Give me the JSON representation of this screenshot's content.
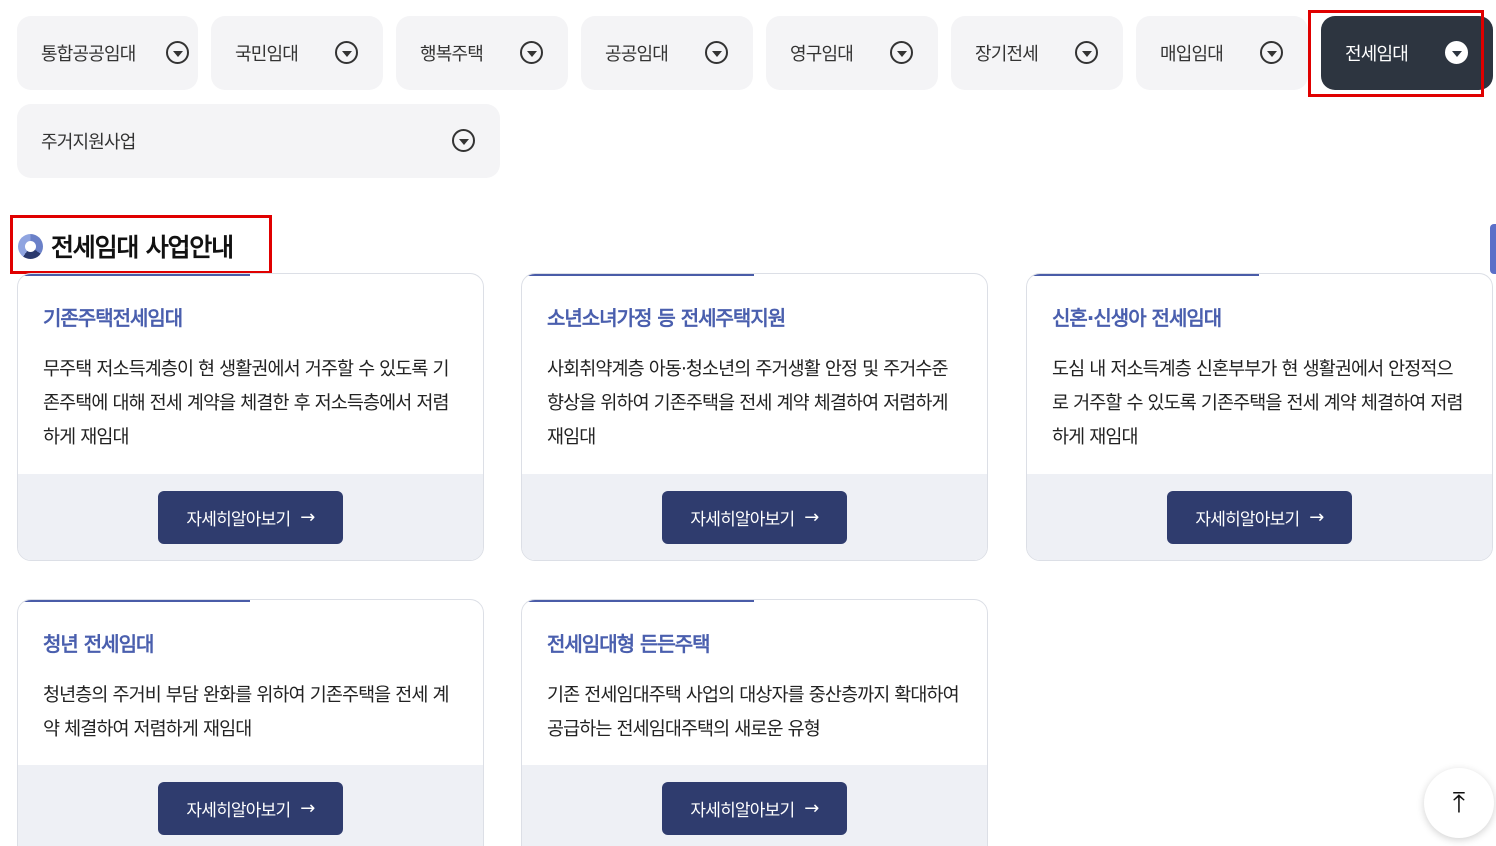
{
  "tabs": [
    {
      "label": "통합공공임대",
      "active": false
    },
    {
      "label": "국민임대",
      "active": false
    },
    {
      "label": "행복주택",
      "active": false
    },
    {
      "label": "공공임대",
      "active": false
    },
    {
      "label": "영구임대",
      "active": false
    },
    {
      "label": "장기전세",
      "active": false
    },
    {
      "label": "매입임대",
      "active": false
    },
    {
      "label": "전세임대",
      "active": true
    },
    {
      "label": "주거지원사업",
      "active": false
    }
  ],
  "section": {
    "title": "전세임대 사업안내"
  },
  "cards": [
    {
      "title": "기존주택전세임대",
      "description": "무주택 저소득계층이 현 생활권에서 거주할 수 있도록 기존주택에 대해 전세 계약을 체결한 후 저소득층에서 저렴하게 재임대",
      "button": "자세히알아보기"
    },
    {
      "title": "소년소녀가정 등 전세주택지원",
      "description": "사회취약계층 아동·청소년의 주거생활 안정 및 주거수준 향상을 위하여 기존주택을 전세 계약 체결하여 저렴하게 재임대",
      "button": "자세히알아보기"
    },
    {
      "title": "신혼·신생아 전세임대",
      "description": "도심 내 저소득계층 신혼부부가 현 생활권에서 안정적으로 거주할 수 있도록 기존주택을 전세 계약 체결하여 저렴하게 재임대",
      "button": "자세히알아보기"
    },
    {
      "title": "청년 전세임대",
      "description": "청년층의 주거비 부담 완화를 위하여 기존주택을 전세 계약 체결하여 저렴하게 재임대",
      "button": "자세히알아보기"
    },
    {
      "title": "전세임대형 든든주택",
      "description": "기존 전세임대주택 사업의 대상자를 중산층까지 확대하여 공급하는 전세임대주택의 새로운 유형",
      "button": "자세히알아보기"
    }
  ],
  "icons": {
    "chevron": "chevron-down-circle-icon",
    "arrow": "arrow-right-icon",
    "top": "arrow-up-to-top-icon",
    "section": "section-logo-icon"
  },
  "colors": {
    "active_tab": "#2d3540",
    "card_title": "#4a5fae",
    "button": "#2f3c6e",
    "highlight": "#e00000"
  }
}
